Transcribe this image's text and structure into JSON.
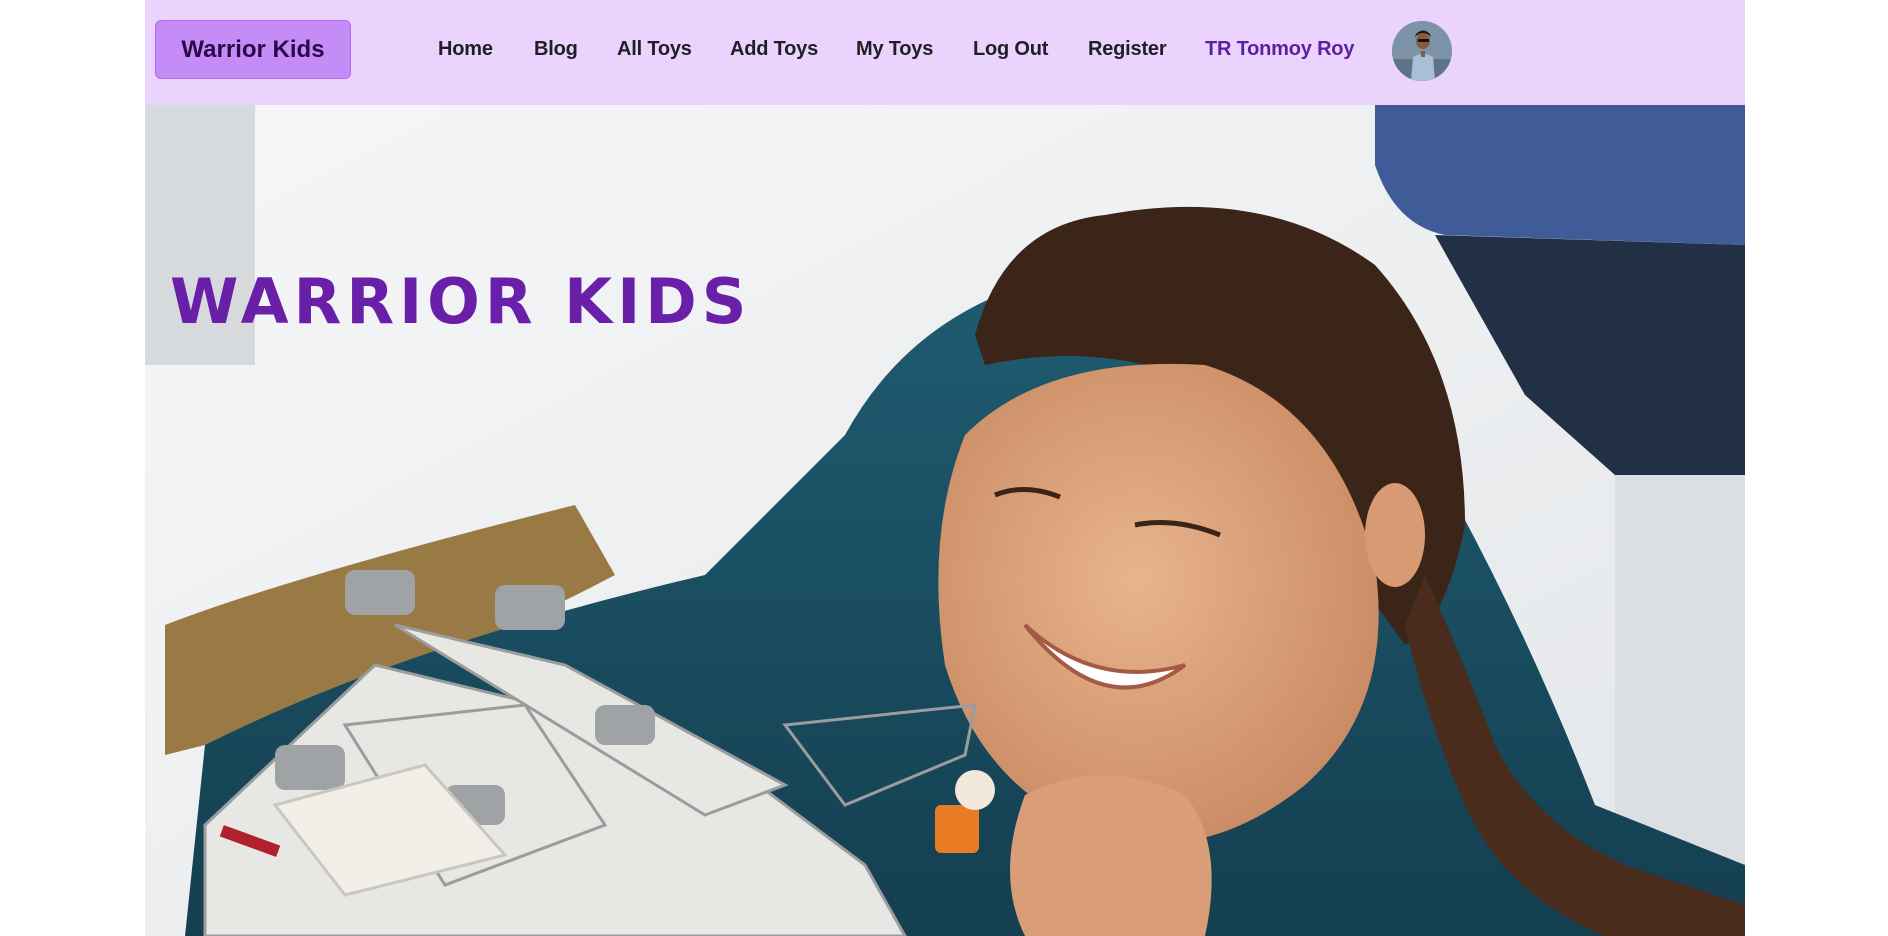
{
  "navbar": {
    "brand": "Warrior Kids",
    "links": [
      "Home",
      "Blog",
      "All Toys",
      "Add Toys",
      "My Toys",
      "Log Out",
      "Register"
    ],
    "user_name": "TR Tonmoy Roy"
  },
  "hero": {
    "title": "WARRIOR KIDS",
    "image": "girl-playing-with-lego-spaceship-photo"
  },
  "colors": {
    "navbar_bg": "#ead4fd",
    "brand_bg": "#c58bf7",
    "hero_title": "#6a1fa8",
    "user_name": "#5b1fa0"
  }
}
